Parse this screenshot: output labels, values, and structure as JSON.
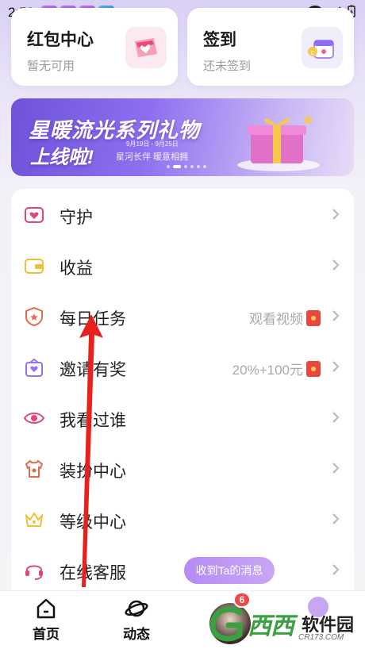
{
  "status_bar": {
    "time": "2:59"
  },
  "top_cards": {
    "red_packet": {
      "title": "红包中心",
      "subtitle": "暂无可用"
    },
    "sign_in": {
      "title": "签到",
      "subtitle": "还未签到"
    }
  },
  "banner": {
    "line1": "星暖流光系列礼物",
    "line2": "上线啦!",
    "date": "9月19日 - 9月25日",
    "sub": "星河长伴  暖意相拥"
  },
  "menu": {
    "items": [
      {
        "label": "守护",
        "icon": "guard-heart-icon",
        "right_text": ""
      },
      {
        "label": "收益",
        "icon": "wallet-icon",
        "right_text": ""
      },
      {
        "label": "每日任务",
        "icon": "daily-task-icon",
        "right_text": "观看视频"
      },
      {
        "label": "邀请有奖",
        "icon": "invite-gift-icon",
        "right_text": "20%+100元"
      },
      {
        "label": "我看过谁",
        "icon": "eye-icon",
        "right_text": ""
      },
      {
        "label": "装扮中心",
        "icon": "shirt-icon",
        "right_text": ""
      },
      {
        "label": "等级中心",
        "icon": "crown-icon",
        "right_text": ""
      },
      {
        "label": "在线客服",
        "icon": "headset-icon",
        "right_text": ""
      }
    ]
  },
  "toast": {
    "text": "收到Ta的消息"
  },
  "bottom_nav": {
    "home": "首页",
    "dynamic": "动态",
    "badge": "6"
  },
  "watermark": {
    "text": "西西",
    "text2": "软件园",
    "url": "CR173.COM"
  },
  "colors": {
    "accent": "#9b6ff2",
    "badge": "#f04848",
    "menu_icon_pink": "#e0457f",
    "menu_icon_yellow": "#f0c030"
  }
}
